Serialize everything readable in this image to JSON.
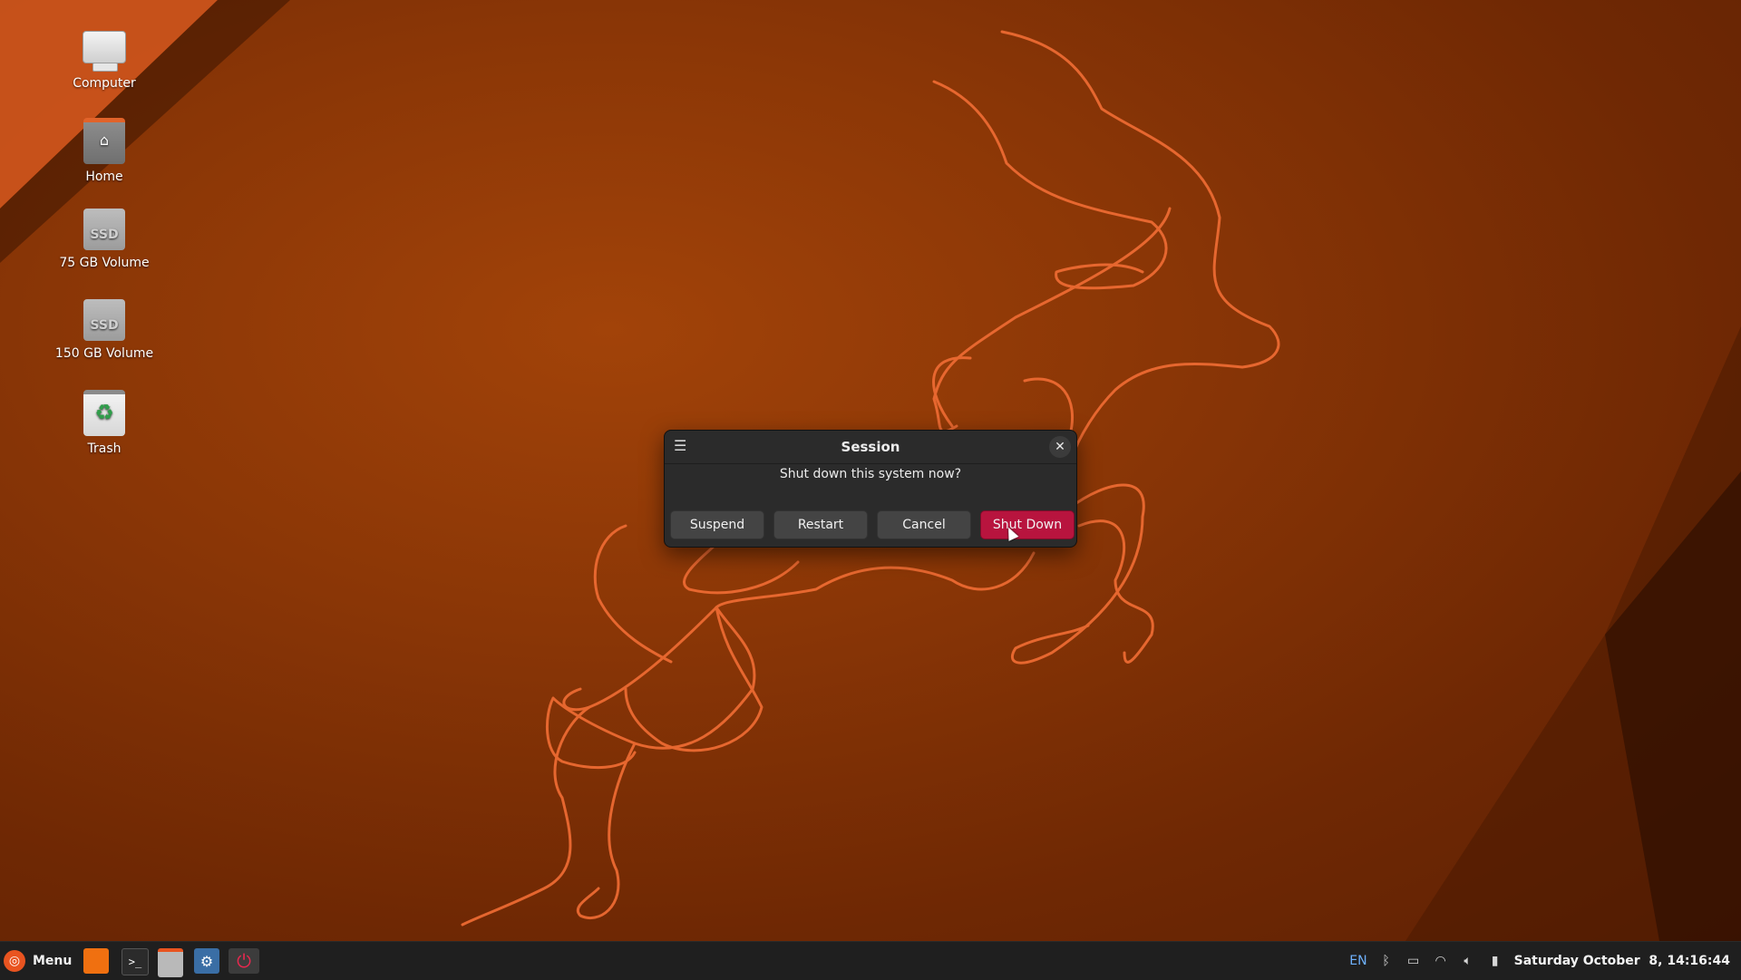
{
  "desktop": {
    "icons": [
      {
        "label": "Computer",
        "icon": "computer-icon"
      },
      {
        "label": "Home",
        "icon": "home-folder-icon"
      },
      {
        "label": "75 GB Volume",
        "icon": "ssd-drive-icon",
        "badge": "SSD"
      },
      {
        "label": "150 GB Volume",
        "icon": "ssd-drive-icon",
        "badge": "SSD"
      },
      {
        "label": "Trash",
        "icon": "trash-icon"
      }
    ]
  },
  "dialog": {
    "title": "Session",
    "message": "Shut down this system now?",
    "buttons": [
      "Suspend",
      "Restart",
      "Cancel",
      "Shut Down"
    ]
  },
  "taskbar": {
    "menu_label": "Menu",
    "language": "EN",
    "clock": "Saturday October  8, 14:16:44"
  },
  "colors": {
    "accent": "#e95420",
    "destructive": "#b8143e",
    "taskbar_bg": "#1f1f1f",
    "dialog_bg": "#2b2b2b"
  }
}
